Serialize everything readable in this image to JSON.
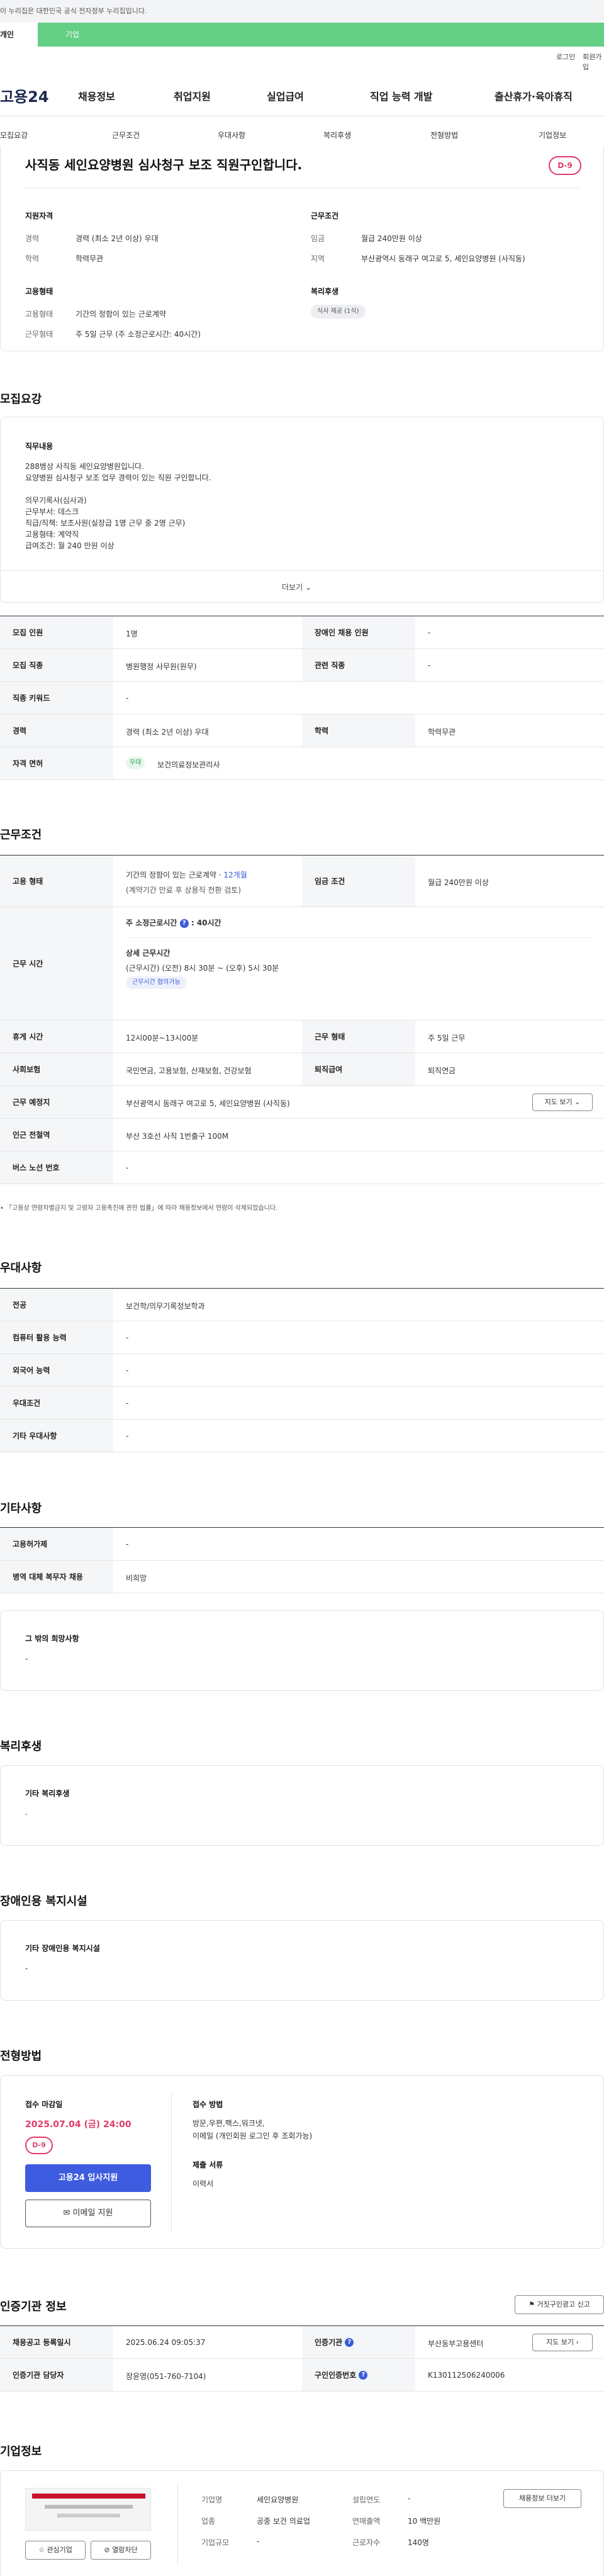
{
  "gov_banner": "이 누리집은 대한민국 공식 전자정부 누리집입니다.",
  "top_tabs": [
    "개인",
    "기업"
  ],
  "util_links": [
    "로그인",
    "회원가입"
  ],
  "logo": "고용24",
  "gnb": [
    "채용정보",
    "취업지원",
    "실업급여",
    "직업 능력 개발",
    "출산휴가·육아휴직"
  ],
  "subnav": [
    "모집요강",
    "근무조건",
    "우대사항",
    "복리후생",
    "전형방법",
    "기업정보"
  ],
  "summary": {
    "title": "사직동 세인요양병원 심사청구 보조 직원구인합니다.",
    "dday": "D-9",
    "qual_heading": "지원자격",
    "career_label": "경력",
    "career_value": "경력 (최소 2년 이상) 우대",
    "edu_label": "학력",
    "edu_value": "학력무관",
    "cond_heading": "근무조건",
    "wage_label": "임금",
    "wage_value": "월급 240만원 이상",
    "loc_label": "지역",
    "loc_value": "부산광역시 동래구 여고로 5, 세인요양병원 (사직동)",
    "emp_heading": "고용형태",
    "type_label": "고용형태",
    "type_value": "기간의 정함이 있는 근로계약",
    "hours_label": "근무형태",
    "hours_value": "주 5일 근무 (주 소정근로시간: 40시간)",
    "welfare_heading": "복리후생",
    "welfare_badge": "식사 제공 (1식)"
  },
  "recruit": {
    "heading": "모집요강",
    "duty_heading": "직무내용",
    "duty_lines": [
      "288병상  사직동 세인요양병원입니다.",
      "요양병원 심사청구 보조  업무 경력이 있는  직원 구인합니다.",
      "",
      "의무기록사(심사과)",
      "근무부서: 데스크",
      "직급/직책: 보조사원(실장급 1명 근무 중 2명 근무)",
      "고용형태: 계약직",
      "급여조건: 월 240 만원 이상"
    ],
    "more": "더보기",
    "rows": {
      "count_label": "모집 인원",
      "count_value": "1명",
      "disabled_label": "장애인 채용 인원",
      "disabled_value": "-",
      "job_label": "모집 직종",
      "job_value": "병원행정 사무원(원무)",
      "related_label": "관련 직종",
      "related_value": "-",
      "keyword_label": "직종 키워드",
      "keyword_value": "-",
      "career_label": "경력",
      "career_value": "경력 (최소 2년 이상) 우대",
      "edu_label": "학력",
      "edu_value": "학력무관",
      "license_label": "자격 면허",
      "license_badge": "우대",
      "license_value": "보건의료정보관리사"
    }
  },
  "work": {
    "heading": "근무조건",
    "type_label": "고용 형태",
    "type_value": "기간의 정함이 있는 근로계약",
    "type_period": "12개월",
    "type_sub": "(계약기간 만료 후 상용직 전환 검토)",
    "wage_label": "임금 조건",
    "wage_value": "월급 240만원 이상",
    "hours_label": "근무 시간",
    "hours_title": "주 소정근로시간",
    "hours_value": "40시간",
    "detail_title": "상세 근무시간",
    "detail_value": "(근무시간) (오전) 8시 30분 ~ (오후) 5시 30분",
    "flex_badge": "근무시간 협의가능",
    "break_label": "휴게 시간",
    "break_value": "12시00분~13시00분",
    "form_label": "근무 형태",
    "form_value": "주 5일 근무",
    "insure_label": "사회보험",
    "insure_value": "국민연금, 고용보험, 산재보험, 건강보험",
    "severance_label": "퇴직급여",
    "severance_value": "퇴직연금",
    "place_label": "근무 예정지",
    "place_value": "부산광역시 동래구 여고로 5, 세인요양병원 (사직동)",
    "map_button": "지도 보기",
    "subway_label": "인근 전철역",
    "subway_value": "부산 3호선 사직 1번출구 100M",
    "bus_label": "버스 노선 번호",
    "bus_value": "-",
    "notice": "「고용상 연령차별금지 및 고령자 고용촉진에 관한 법률」에 따라 채용정보에서 연령이 삭제되었습니다."
  },
  "pref": {
    "heading": "우대사항",
    "rows": [
      {
        "label": "전공",
        "value": "보건학/의무기록정보학과"
      },
      {
        "label": "컴퓨터 활용 능력",
        "value": "-"
      },
      {
        "label": "외국어 능력",
        "value": "-"
      },
      {
        "label": "우대조건",
        "value": "-"
      },
      {
        "label": "기타 우대사항",
        "value": "-"
      }
    ]
  },
  "etc": {
    "heading": "기타사항",
    "rows": [
      {
        "label": "고용허가제",
        "value": "-"
      },
      {
        "label": "병역 대체 복무자 채용",
        "value": "비희망"
      }
    ],
    "wish_title": "그 밖의 희망사항",
    "wish_value": "-"
  },
  "welfare": {
    "heading": "복리후생",
    "box_title": "기타 복리후생",
    "box_value": "."
  },
  "disability": {
    "heading": "장애인용 복지시설",
    "box_title": "기타 장애인용 복지시설",
    "box_value": "-"
  },
  "process": {
    "heading": "전형방법",
    "deadline_label": "접수 마감일",
    "deadline_value": "2025.07.04 (금) 24:00",
    "dday": "D-9",
    "apply_button": "고용24 입사지원",
    "email_button": "이메일 지원",
    "method_label": "접수 방법",
    "method_value1": "방문,우편,팩스,워크넷,",
    "method_value2": "이메일 (개인회원 로그인 후 조회가능)",
    "docs_label": "제출 서류",
    "docs_value": "이력서"
  },
  "cert": {
    "heading": "인증기관 정보",
    "report_button": "거짓구인광고 신고",
    "reg_label": "채용공고 등록일시",
    "reg_value": "2025.06.24 09:05:37",
    "agency_label": "인증기관",
    "agency_value": "부산동부고용센터",
    "manager_label": "인증기관 담당자",
    "manager_value": "장윤영(051-760-7104)",
    "id_label": "구인인증번호",
    "id_value": "K130112506240006",
    "map_button": "지도 보기"
  },
  "company": {
    "heading": "기업정보",
    "interest_button": "관심기업",
    "block_button": "열람차단",
    "name_label": "기업명",
    "name_value": "세인요양병원",
    "biz_label": "업종",
    "biz_value": "공중 보건 의료업",
    "size_label": "기업규모",
    "size_value": "-",
    "year_label": "설립연도",
    "year_value": "-",
    "sales_label": "연매출액",
    "sales_value": "10 백만원",
    "staff_label": "근로자수",
    "staff_value": "140명",
    "jobs_button": "채용정보 더보기"
  }
}
